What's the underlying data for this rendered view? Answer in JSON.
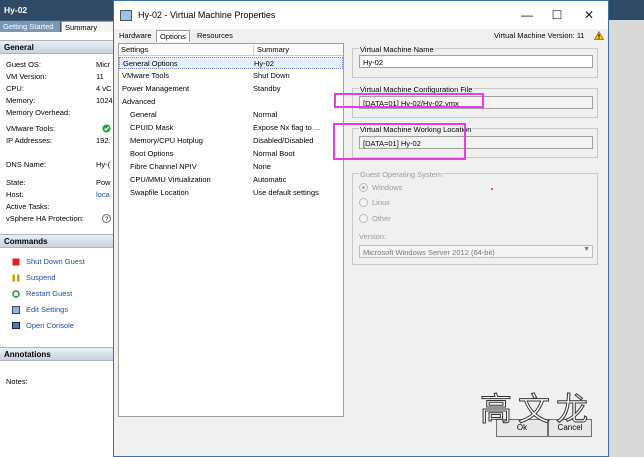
{
  "background": {
    "title": "Hy-02",
    "tabs": [
      "Getting Started",
      "Summary"
    ],
    "general": {
      "header": "General",
      "rows": [
        {
          "k": "Guest OS:",
          "v": "Micr"
        },
        {
          "k": "VM Version:",
          "v": "11"
        },
        {
          "k": "CPU:",
          "v": "4 vC"
        },
        {
          "k": "Memory:",
          "v": "1024"
        },
        {
          "k": "Memory Overhead:",
          "v": ""
        },
        {
          "k": "VMware Tools:",
          "v": ""
        },
        {
          "k": "IP Addresses:",
          "v": "192."
        },
        {
          "k": "DNS Name:",
          "v": "Hy-("
        },
        {
          "k": "State:",
          "v": "Pow"
        },
        {
          "k": "Host:",
          "v": "loca"
        },
        {
          "k": "Active Tasks:",
          "v": ""
        },
        {
          "k": "vSphere HA Protection:",
          "v": ""
        }
      ]
    },
    "commands": {
      "header": "Commands",
      "items": [
        "Shut Down Guest",
        "Suspend",
        "Restart Guest",
        "Edit Settings",
        "Open Console"
      ]
    },
    "annotations": {
      "header": "Annotations",
      "notes_label": "Notes:"
    }
  },
  "dialog": {
    "title": "Hy-02 - Virtual Machine Properties",
    "tabs": [
      "Hardware",
      "Options",
      "Resources"
    ],
    "vm_version": "Virtual Machine Version: 11",
    "list": {
      "col_settings": "Settings",
      "col_summary": "Summary",
      "rows": [
        {
          "setting": "General Options",
          "summary": "Hy-02"
        },
        {
          "setting": "VMware Tools",
          "summary": "Shut Down"
        },
        {
          "setting": "Power Management",
          "summary": "Standby"
        },
        {
          "setting": "Advanced",
          "summary": ""
        },
        {
          "setting": "General",
          "summary": "Normal"
        },
        {
          "setting": "CPUID Mask",
          "summary": "Expose Nx flag to ..."
        },
        {
          "setting": "Memory/CPU Hotplug",
          "summary": "Disabled/Disabled"
        },
        {
          "setting": "Boot Options",
          "summary": "Normal Boot"
        },
        {
          "setting": "Fibre Channel NPIV",
          "summary": "None"
        },
        {
          "setting": "CPU/MMU Virtualization",
          "summary": "Automatic"
        },
        {
          "setting": "Swapfile Location",
          "summary": "Use default settings"
        }
      ]
    },
    "vm_name": {
      "label": "Virtual Machine Name",
      "value": "Hy-02"
    },
    "config_file": {
      "label": "Virtual Machine Configuration File",
      "value": "[DATA=01] Hy-02/Hy-02.vmx"
    },
    "working_location": {
      "label": "Virtual Machine Working Location",
      "value": "[DATA=01] Hy-02"
    },
    "guest_os": {
      "label": "Guest Operating System",
      "options": [
        "Windows",
        "Linux",
        "Other"
      ],
      "version_label": "Version:",
      "version_value": "Microsoft Windows Server 2012 (64-bit)"
    },
    "buttons": {
      "ok": "Ok",
      "cancel": "Cancel"
    }
  },
  "watermark": "高文龙",
  "colors": {
    "highlight": "#e040e0",
    "link": "#1a4ea8",
    "header_bar": "#2f4a64"
  }
}
